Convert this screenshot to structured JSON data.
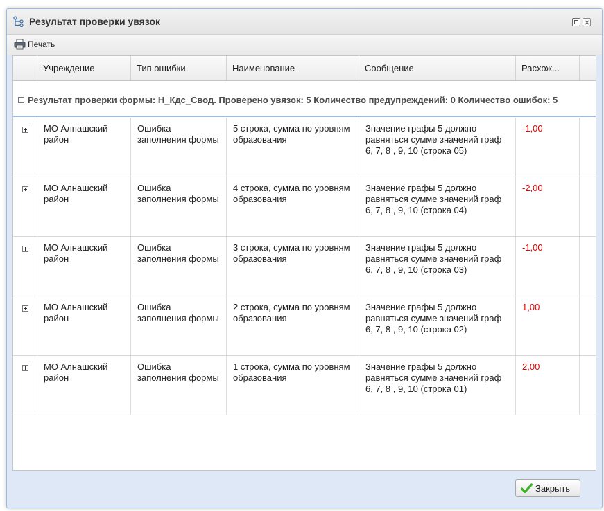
{
  "window": {
    "title": "Результат проверки увязок"
  },
  "toolbar": {
    "print_label": "Печать"
  },
  "grid": {
    "columns": [
      "Учреждение",
      "Тип ошибки",
      "Наименование",
      "Сообщение",
      "Расхож..."
    ],
    "group_header": "Результат проверки формы: Н_Кдс_Свод. Проверено увязок: 5 Количество предупреждений: 0 Количество ошибок: 5",
    "rows": [
      {
        "org": "МО Алнашский район",
        "type": "Ошибка заполнения формы",
        "name": "5 строка, сумма по уровням образования",
        "message": "Значение графы 5 должно равняться сумме значений граф 6, 7, 8 , 9, 10 (строка 05)",
        "diff": "-1,00"
      },
      {
        "org": "МО Алнашский район",
        "type": "Ошибка заполнения формы",
        "name": "4 строка, сумма по уровням образования",
        "message": "Значение графы 5 должно равняться сумме значений граф 6, 7, 8 , 9, 10 (строка 04)",
        "diff": "-2,00"
      },
      {
        "org": "МО Алнашский район",
        "type": "Ошибка заполнения формы",
        "name": "3 строка, сумма по уровням образования",
        "message": "Значение графы 5 должно равняться сумме значений граф 6, 7, 8 , 9, 10 (строка 03)",
        "diff": "-1,00"
      },
      {
        "org": "МО Алнашский район",
        "type": "Ошибка заполнения формы",
        "name": "2 строка, сумма по уровням образования",
        "message": "Значение графы 5 должно равняться сумме значений граф 6, 7, 8 , 9, 10 (строка 02)",
        "diff": "1,00"
      },
      {
        "org": "МО Алнашский район",
        "type": "Ошибка заполнения формы",
        "name": "1 строка, сумма по уровням образования",
        "message": "Значение графы 5 должно равняться сумме значений граф 6, 7, 8 , 9, 10 (строка 01)",
        "diff": "2,00"
      }
    ]
  },
  "footer": {
    "close_label": "Закрыть"
  },
  "colors": {
    "negative_value": "#e00000",
    "frame_border": "#99bbe8",
    "close_check": "#3cb527"
  },
  "icons": {
    "title": "hierarchy-icon",
    "print": "printer-icon",
    "close_button": "checkmark-icon"
  }
}
